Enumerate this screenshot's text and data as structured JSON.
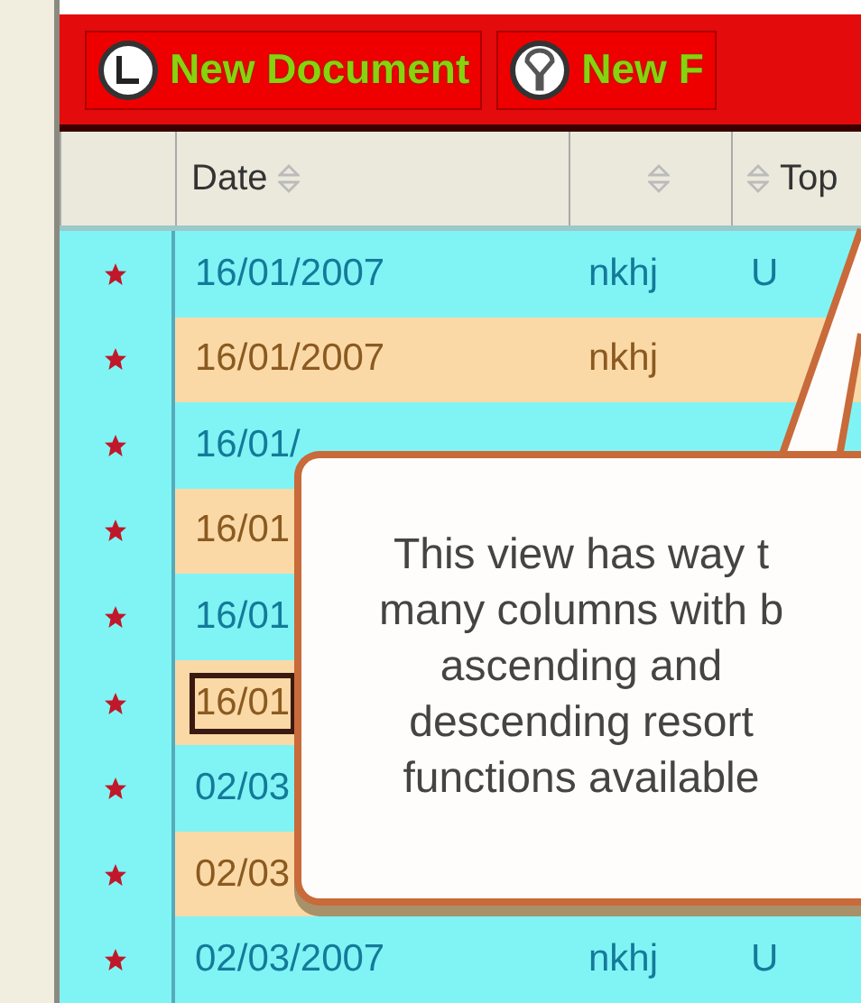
{
  "toolbar": {
    "buttons": [
      {
        "label": "New Document"
      },
      {
        "label": "New F"
      }
    ]
  },
  "table": {
    "columns": [
      {
        "label": "Date",
        "sortable": true
      },
      {
        "sortable": true
      },
      {
        "label": "Top",
        "sortable": true
      }
    ],
    "rows": [
      {
        "flagged": true,
        "selected": false,
        "cells": [
          "16/01/2007",
          "nkhj",
          "U"
        ]
      },
      {
        "flagged": true,
        "selected": false,
        "cells": [
          "16/01/2007",
          "nkhj"
        ]
      },
      {
        "flagged": true,
        "selected": false,
        "cells": [
          "16/01/"
        ]
      },
      {
        "flagged": true,
        "selected": false,
        "cells": [
          "16/01"
        ]
      },
      {
        "flagged": true,
        "selected": false,
        "cells": [
          "16/01"
        ]
      },
      {
        "flagged": true,
        "selected": true,
        "cells": [
          "16/01"
        ]
      },
      {
        "flagged": true,
        "selected": false,
        "cells": [
          "02/03"
        ]
      },
      {
        "flagged": true,
        "selected": false,
        "cells": [
          "02/03"
        ]
      },
      {
        "flagged": true,
        "selected": false,
        "cells": [
          "02/03/2007",
          "nkhj",
          "U"
        ]
      }
    ]
  },
  "callout": {
    "lines": [
      "This view has way t",
      "many columns with b",
      "ascending and",
      "descending resort",
      "functions available"
    ]
  }
}
